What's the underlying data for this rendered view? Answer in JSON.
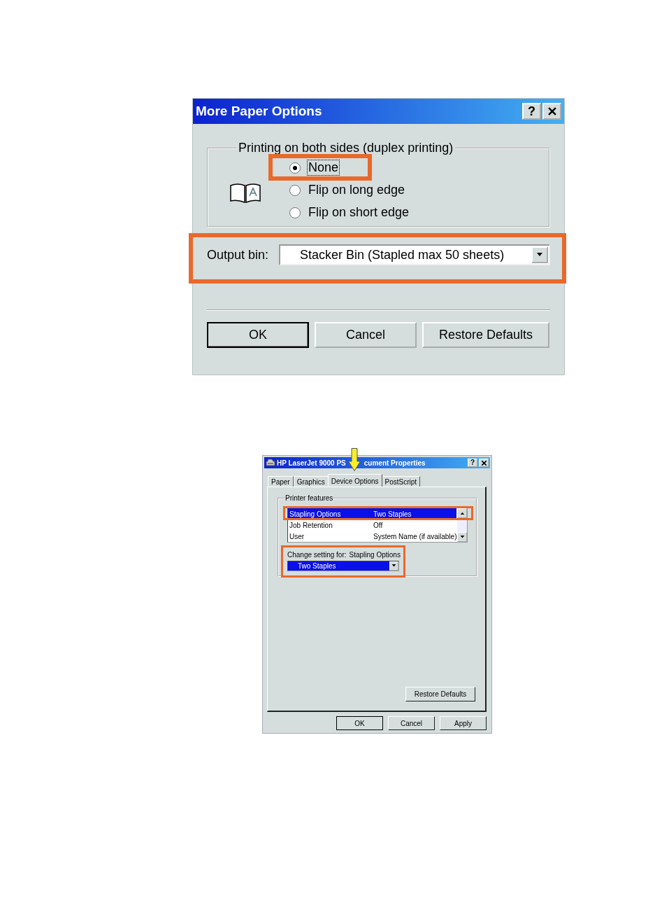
{
  "more_paper_options": {
    "title": "More Paper Options",
    "help_button": "?",
    "duplex": {
      "label": "Printing on both sides (duplex printing)",
      "options": [
        {
          "label": "None",
          "selected": true,
          "focused": true,
          "highlighted": true
        },
        {
          "label": "Flip on long edge",
          "selected": false,
          "focused": false,
          "highlighted": false
        },
        {
          "label": "Flip on short edge",
          "selected": false,
          "focused": false,
          "highlighted": false
        }
      ]
    },
    "output_bin": {
      "label": "Output bin:",
      "value": "Stacker Bin (Stapled max 50 sheets)",
      "highlighted": true
    },
    "buttons": [
      {
        "label": "OK",
        "default": true
      },
      {
        "label": "Cancel",
        "default": false
      },
      {
        "label": "Restore Defaults",
        "default": false
      }
    ]
  },
  "document_properties": {
    "title_parts": [
      "HP LaserJet 9000 PS",
      "cument Properties"
    ],
    "help_button": "?",
    "tabs": [
      {
        "label": "Paper",
        "selected": false
      },
      {
        "label": "Graphics",
        "selected": false
      },
      {
        "label": "Device Options",
        "selected": true
      },
      {
        "label": "PostScript",
        "selected": false
      }
    ],
    "printer_features": {
      "label": "Printer features",
      "rows": [
        {
          "name": "Stapling Options",
          "value": "Two Staples",
          "selected": true,
          "highlighted": true
        },
        {
          "name": "Job Retention",
          "value": "Off",
          "selected": false,
          "highlighted": false
        },
        {
          "name": "User",
          "value": "System Name (if available)",
          "selected": false,
          "highlighted": false
        }
      ]
    },
    "change_setting": {
      "label": "Change setting for:",
      "target": "Stapling Options",
      "value": "Two Staples",
      "highlighted": true
    },
    "restore_button": "Restore Defaults",
    "buttons": [
      {
        "label": "OK"
      },
      {
        "label": "Cancel"
      },
      {
        "label": "Apply"
      }
    ]
  }
}
